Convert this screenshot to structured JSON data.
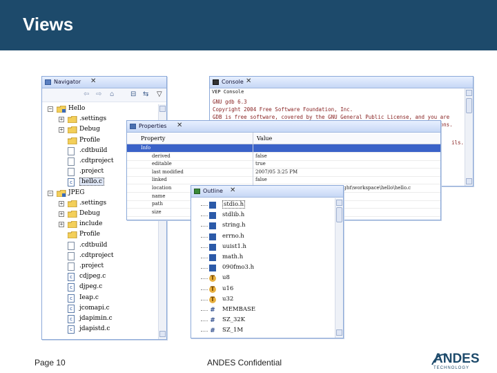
{
  "slide": {
    "title": "Views",
    "footer_page": "Page 10",
    "footer_confidential": "ANDES Confidential",
    "logo_text": "ANDES",
    "logo_subtext": "TECHNOLOGY"
  },
  "colors": {
    "header_bg": "#1d4a6b",
    "selection": "#3a62c8",
    "console_text": "#882222"
  },
  "navigator": {
    "title": "Navigator",
    "toolbar_icons": [
      "back-icon",
      "forward-icon",
      "home-icon",
      "collapse-icon",
      "link-icon",
      "menu-icon"
    ],
    "items": [
      {
        "label": "Hello",
        "kind": "project",
        "expanded": true
      },
      {
        "label": ".settings",
        "kind": "folder"
      },
      {
        "label": "Debug",
        "kind": "folder"
      },
      {
        "label": "Profile",
        "kind": "folder"
      },
      {
        "label": ".cdtbuild",
        "kind": "file"
      },
      {
        "label": ".cdtproject",
        "kind": "file"
      },
      {
        "label": ".project",
        "kind": "file"
      },
      {
        "label": "hello.c",
        "kind": "cfile",
        "selected": true
      },
      {
        "label": "JPEG",
        "kind": "project",
        "expanded": true
      },
      {
        "label": ".settings",
        "kind": "folder"
      },
      {
        "label": "Debug",
        "kind": "folder"
      },
      {
        "label": "include",
        "kind": "folder"
      },
      {
        "label": "Profile",
        "kind": "folder"
      },
      {
        "label": ".cdtbuild",
        "kind": "file"
      },
      {
        "label": ".cdtproject",
        "kind": "file"
      },
      {
        "label": ".project",
        "kind": "file"
      },
      {
        "label": "cdjpeg.c",
        "kind": "cfile"
      },
      {
        "label": "djpeg.c",
        "kind": "cfile"
      },
      {
        "label": "Ieap.c",
        "kind": "cfile"
      },
      {
        "label": "jcomapi.c",
        "kind": "cfile"
      },
      {
        "label": "jdapimin.c",
        "kind": "cfile"
      },
      {
        "label": "jdapistd.c",
        "kind": "cfile"
      }
    ]
  },
  "console": {
    "title": "Console",
    "subtitle": "VEP Console",
    "lines": [
      "GNU gdb 6.3",
      "Copyright 2004 Free Software Foundation, Inc.",
      "GDB is free software, covered by the GNU General Public License, and you are",
      "welcome to change it and/or distribute copies of it under certain conditions."
    ],
    "tail": "ils."
  },
  "properties": {
    "title": "Properties",
    "col_property": "Property",
    "col_value": "Value",
    "rows": [
      {
        "property": "Info",
        "value": "",
        "selected": true
      },
      {
        "property": "derived",
        "value": "false"
      },
      {
        "property": "editable",
        "value": "true"
      },
      {
        "property": "last modified",
        "value": "2007/05 3:25 PM"
      },
      {
        "property": "linked",
        "value": "false"
      },
      {
        "property": "location",
        "value": "C:\\Program Files\\Andestech\\AndeSight\\workspace\\hello\\hello.c"
      },
      {
        "property": "name",
        "value": "hello.c"
      },
      {
        "property": "path",
        "value": ""
      },
      {
        "property": "size",
        "value": ""
      }
    ]
  },
  "outline": {
    "title": "Outline",
    "items": [
      {
        "label": "stdio.h",
        "kind": "include",
        "selected": true
      },
      {
        "label": "stdlib.h",
        "kind": "include"
      },
      {
        "label": "string.h",
        "kind": "include"
      },
      {
        "label": "errno.h",
        "kind": "include"
      },
      {
        "label": "uuist1.h",
        "kind": "include"
      },
      {
        "label": "math.h",
        "kind": "include"
      },
      {
        "label": "090fmo3.h",
        "kind": "include"
      },
      {
        "label": "u8",
        "kind": "typedef"
      },
      {
        "label": "u16",
        "kind": "typedef"
      },
      {
        "label": "u32",
        "kind": "typedef"
      },
      {
        "label": "MEMBASE",
        "kind": "define"
      },
      {
        "label": "SZ_32K",
        "kind": "define"
      },
      {
        "label": "SZ_1M",
        "kind": "define"
      },
      {
        "label": "SZ_2M",
        "kind": "define"
      }
    ]
  }
}
